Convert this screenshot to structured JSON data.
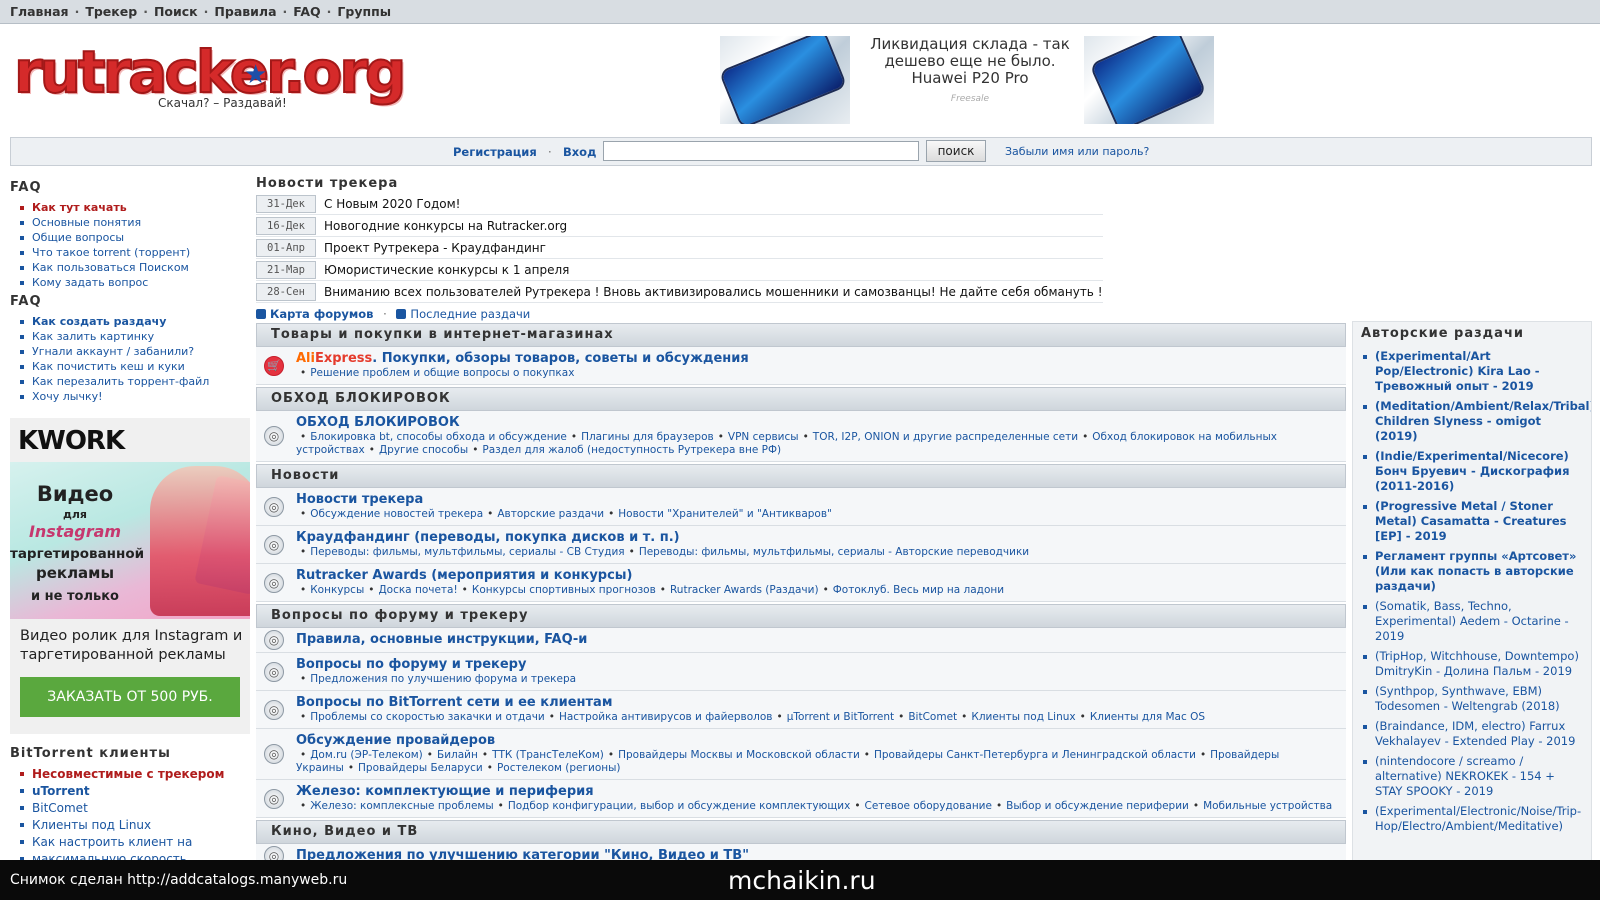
{
  "topnav": [
    "Главная",
    "Трекер",
    "Поиск",
    "Правила",
    "FAQ",
    "Группы"
  ],
  "logo": {
    "word": "rutracker.org",
    "slogan": "Скачал? – Раздавай!"
  },
  "ad": {
    "line1": "Ликвидация склада - так",
    "line2": "дешево еще не было.",
    "line3": "Huawei P20 Pro",
    "small": "Freesale"
  },
  "login": {
    "register": "Регистрация",
    "login": "Вход",
    "search_button": "поиск",
    "forgot": "Забыли имя или пароль?"
  },
  "left": {
    "faq1_title": "FAQ",
    "faq1_items": [
      "Как тут качать",
      "Основные понятия",
      "Общие вопросы",
      "Что такое torrent (торрент)",
      "Как пользоваться Поиском",
      "Кому задать вопрос"
    ],
    "faq2_title": "FAQ",
    "faq2_items": [
      "Как создать раздачу",
      "Как залить картинку",
      "Угнали аккаунт / забанили?",
      "Как почистить кеш и куки",
      "Как перезалить торрент-файл",
      "Хочу лычку!"
    ],
    "kwork": {
      "logo": "KWORK",
      "img_line1": "Видео",
      "img_line2": "для",
      "img_line3": "Instagram",
      "img_line4": "таргетированной",
      "img_line5": "рекламы",
      "img_line6": "и не только",
      "text": "Видео ролик для Instagram и таргетированной рекламы",
      "button": "ЗАКАЗАТЬ ОТ 500 РУБ."
    },
    "bt_title": "BitTorrent клиенты",
    "bt_items": [
      "Несовместимые с трекером",
      "uTorrent",
      "BitComet",
      "Клиенты под Linux",
      "Как настроить клиент на",
      "максимальную скорость"
    ]
  },
  "news": {
    "title": "Новости трекера",
    "items": [
      {
        "date": "31-Дек",
        "text": "С Новым 2020 Годом!"
      },
      {
        "date": "16-Дек",
        "text": "Новогодние конкурсы на Rutracker.org"
      },
      {
        "date": "01-Апр",
        "text": "Проект Рутрекера - Краудфандинг"
      },
      {
        "date": "21-Мар",
        "text": "Юмористические конкурсы к 1 апреля"
      },
      {
        "date": "28-Сен",
        "text": "Вниманию всех пользователей Рутрекера ! Вновь активизировались мошенники и самозванцы! Не дайте себя обмануть !"
      }
    ]
  },
  "links": {
    "map": "Карта форумов",
    "latest": "Последние раздачи"
  },
  "categories": [
    {
      "title": "Товары и покупки в интернет-магазинах",
      "forums": [
        {
          "ali": true,
          "title_a": "Ali",
          "title_e": "Express",
          "title": ". Покупки, обзоры товаров, советы и обсуждения",
          "subs": [
            "Решение проблем и общие вопросы о покупках"
          ]
        }
      ]
    },
    {
      "title": "ОБХОД БЛОКИРОВОК",
      "forums": [
        {
          "title": "ОБХОД БЛОКИРОВОК",
          "subs": [
            "Блокировка bt, способы обхода и обсуждение",
            "Плагины для браузеров",
            "VPN сервисы",
            "TOR, I2P, ONION и другие распределенные сети",
            "Обход блокировок на мобильных устройствах",
            "Другие способы",
            "Раздел для жалоб (недоступность Рутрекера вне РФ)"
          ]
        }
      ]
    },
    {
      "title": "Новости",
      "forums": [
        {
          "title": "Новости трекера",
          "subs": [
            "Обсуждение новостей трекера",
            "Авторские раздачи",
            "Новости \"Хранителей\" и \"Антикваров\""
          ]
        },
        {
          "title": "Краудфандинг (переводы, покупка дисков и т. п.)",
          "subs": [
            "Переводы: фильмы, мультфильмы, сериалы - СВ Студия",
            "Переводы: фильмы, мультфильмы, сериалы - Авторские переводчики"
          ]
        },
        {
          "title": "Rutracker Awards (мероприятия и конкурсы)",
          "subs": [
            "Конкурсы",
            "Доска почета!",
            "Конкурсы спортивных прогнозов",
            "Rutracker Awards (Раздачи)",
            "Фотоклуб. Весь мир на ладони"
          ]
        }
      ]
    },
    {
      "title": "Вопросы по форуму и трекеру",
      "forums": [
        {
          "title": "Правила, основные инструкции, FAQ-и",
          "subs": []
        },
        {
          "title": "Вопросы по форуму и трекеру",
          "subs": [
            "Предложения по улучшению форума и трекера"
          ]
        },
        {
          "title": "Вопросы по BitTorrent сети и ее клиентам",
          "subs": [
            "Проблемы со скоростью закачки и отдачи",
            "Настройка антивирусов и файерволов",
            "µTorrent и BitTorrent",
            "BitComet",
            "Клиенты под Linux",
            "Клиенты для Mac OS"
          ]
        },
        {
          "title": "Обсуждение провайдеров",
          "subs": [
            "Дом.ru (ЭР-Телеком)",
            "Билайн",
            "ТТК (ТрансТелеКом)",
            "Провайдеры Москвы и Московской области",
            "Провайдеры Санкт-Петербурга и Ленинградской области",
            "Провайдеры Украины",
            "Провайдеры Беларуси",
            "Ростелеком (регионы)"
          ]
        },
        {
          "title": "Железо: комплектующие и периферия",
          "subs": [
            "Железо: комплексные проблемы",
            "Подбор конфигурации, выбор и обсуждение комплектующих",
            "Сетевое оборудование",
            "Выбор и обсуждение периферии",
            "Мобильные устройства"
          ]
        }
      ]
    },
    {
      "title": "Кино, Видео и ТВ",
      "forums": [
        {
          "title": "Предложения по улучшению категории \"Кино, Видео и ТВ\"",
          "subs": []
        }
      ]
    }
  ],
  "right": {
    "title": "Авторские раздачи",
    "items": [
      {
        "text": "(Experimental/Art Pop/Electronic) Kira Lao - Тревожный опыт - 2019",
        "bold": true
      },
      {
        "text": "(Meditation/Ambient/Relax/Tribal) Children Slyness - omigot (2019)",
        "bold": true
      },
      {
        "text": "(Indie/Experimental/Nicecore) Бонч Бруевич - Дискография (2011-2016)",
        "bold": true
      },
      {
        "text": "(Progressive Metal / Stoner Metal) Casamatta - Creatures [EP] - 2019",
        "bold": true
      },
      {
        "text": "Регламент группы «Артсовет» (Или как попасть в авторские раздачи)",
        "bold": true
      },
      {
        "text": "(Somatik, Bass, Techno, Experimental) Aedem - Octarine - 2019",
        "bold": false
      },
      {
        "text": "(TripHop, Witchhouse, Downtempo) DmitryKin - Долина Пальм - 2019",
        "bold": false
      },
      {
        "text": "(Synthpop, Synthwave, EBM) Todesomen - Weltengrab (2018)",
        "bold": false
      },
      {
        "text": "(Braindance, IDM, electro) Farrux Vekhalayev - Extended Play - 2019",
        "bold": false
      },
      {
        "text": "(nintendocore / screamo / alternative) NEKROKEK - 154 + STAY SPOOKY - 2019",
        "bold": false
      },
      {
        "text": "(Experimental/Electronic/Noise/Trip-Hop/Electro/Ambient/Meditative)",
        "bold": false
      }
    ]
  },
  "footer": {
    "left": "Снимок сделан http://addcatalogs.manyweb.ru",
    "center": "mchaikin.ru"
  }
}
